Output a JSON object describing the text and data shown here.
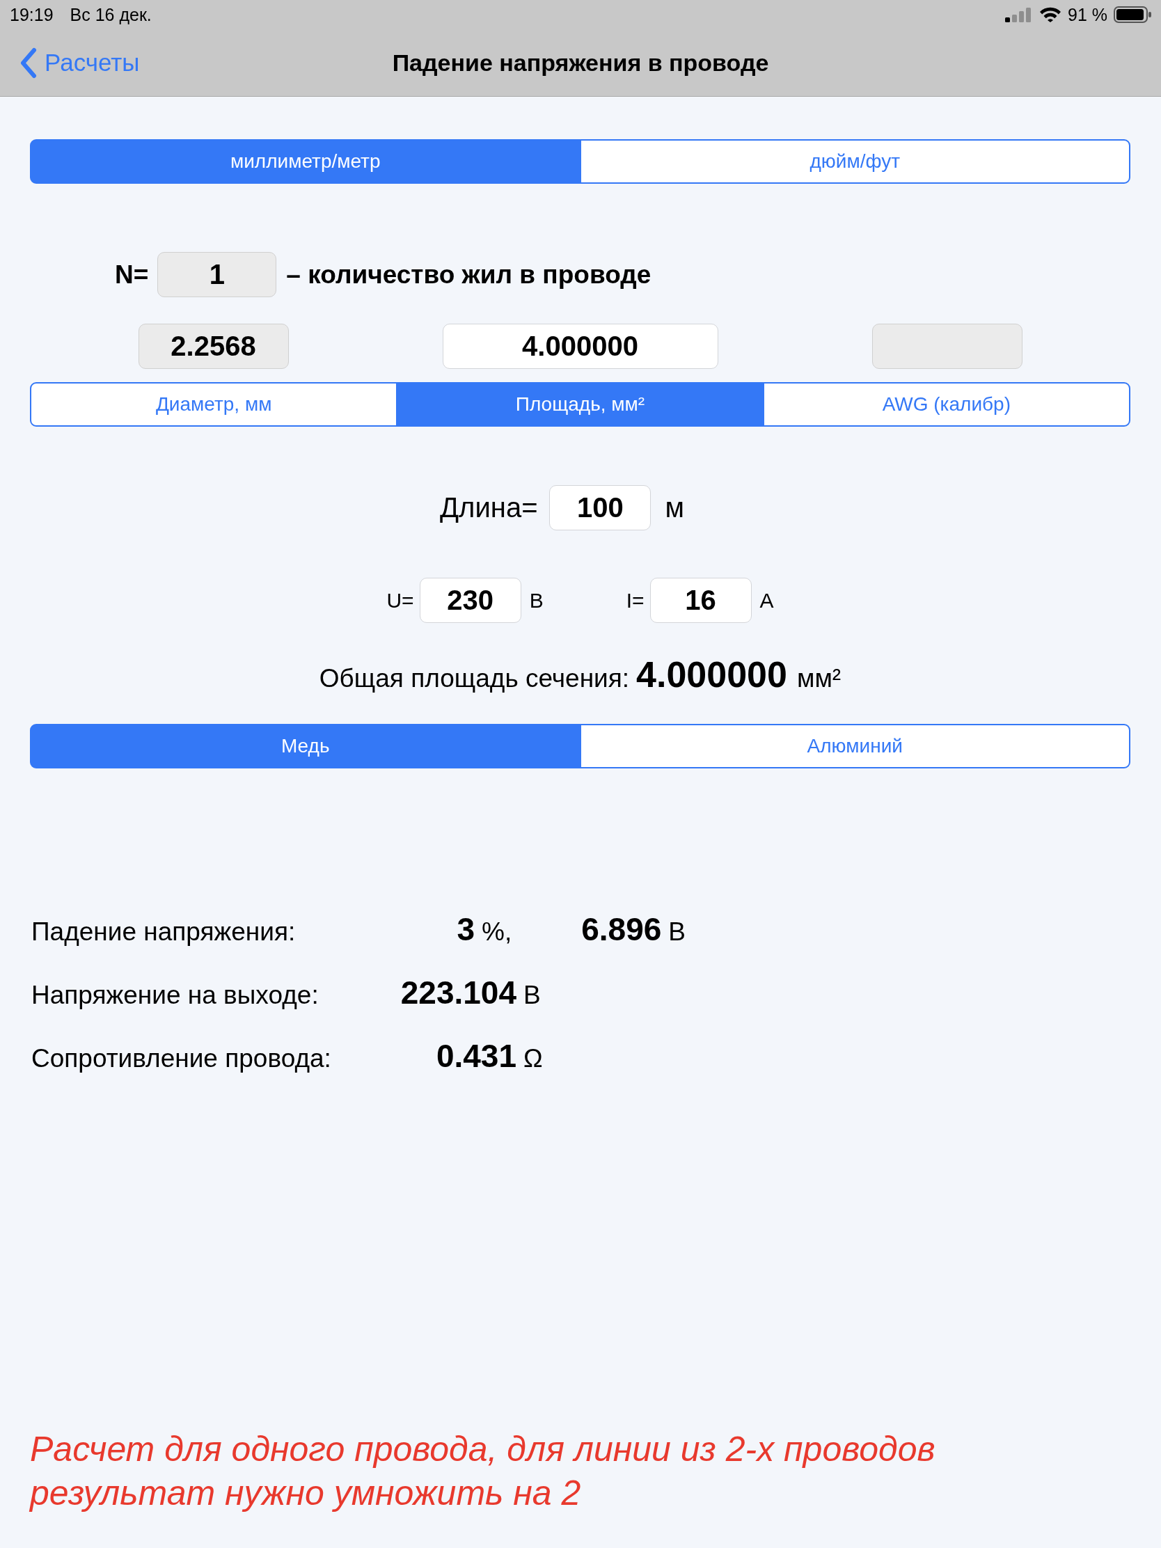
{
  "status_bar": {
    "time": "19:19",
    "date": "Вс 16 дек.",
    "battery": "91 %"
  },
  "nav_bar": {
    "back": "Расчеты",
    "title": "Падение напряжения в проводе"
  },
  "unit_system": [
    {
      "label": "миллиметр/метр",
      "selected": true
    },
    {
      "label": "дюйм/фут",
      "selected": false
    }
  ],
  "cores": {
    "label": "N=",
    "value": "1",
    "disabled": true,
    "description": "– количество жил в проводе"
  },
  "size_fields": [
    {
      "value": "2.2568",
      "disabled": true
    },
    {
      "value": "4.000000",
      "disabled": false
    },
    {
      "disabled": true
    }
  ],
  "size_mode": [
    {
      "label": "Диаметр, мм",
      "selected": false
    },
    {
      "label": "Площадь, мм²",
      "selected": true
    },
    {
      "label": "AWG (калибр)",
      "selected": false
    }
  ],
  "length": {
    "label": "Длина=",
    "value": "100",
    "disabled": false,
    "unit": "м"
  },
  "voltage": {
    "label": "U=",
    "value": "230",
    "disabled": false,
    "unit": "В"
  },
  "current": {
    "label": "I=",
    "value": "16",
    "disabled": false,
    "unit": "А"
  },
  "total_area": {
    "label": "Общая площадь сечения:",
    "value": "4.000000",
    "unit": "мм²"
  },
  "material": [
    {
      "label": "Медь",
      "selected": true
    },
    {
      "label": "Алюминий",
      "selected": false
    }
  ],
  "results": [
    {
      "label": "Падение напряжения:",
      "values": [
        {
          "value": "3",
          "unit": "%,"
        },
        {
          "value": "6.896",
          "unit": "В"
        }
      ]
    },
    {
      "label": "Напряжение на выходе:",
      "values": [
        {
          "value": "223.104",
          "unit": "В"
        }
      ]
    },
    {
      "label": "Сопротивление провода:",
      "values": [
        {
          "value": "0.431",
          "unit": "Ω"
        }
      ]
    }
  ],
  "note": "Расчет для одного провода, для линии из 2-х проводов\nрезультат нужно умножить на 2"
}
